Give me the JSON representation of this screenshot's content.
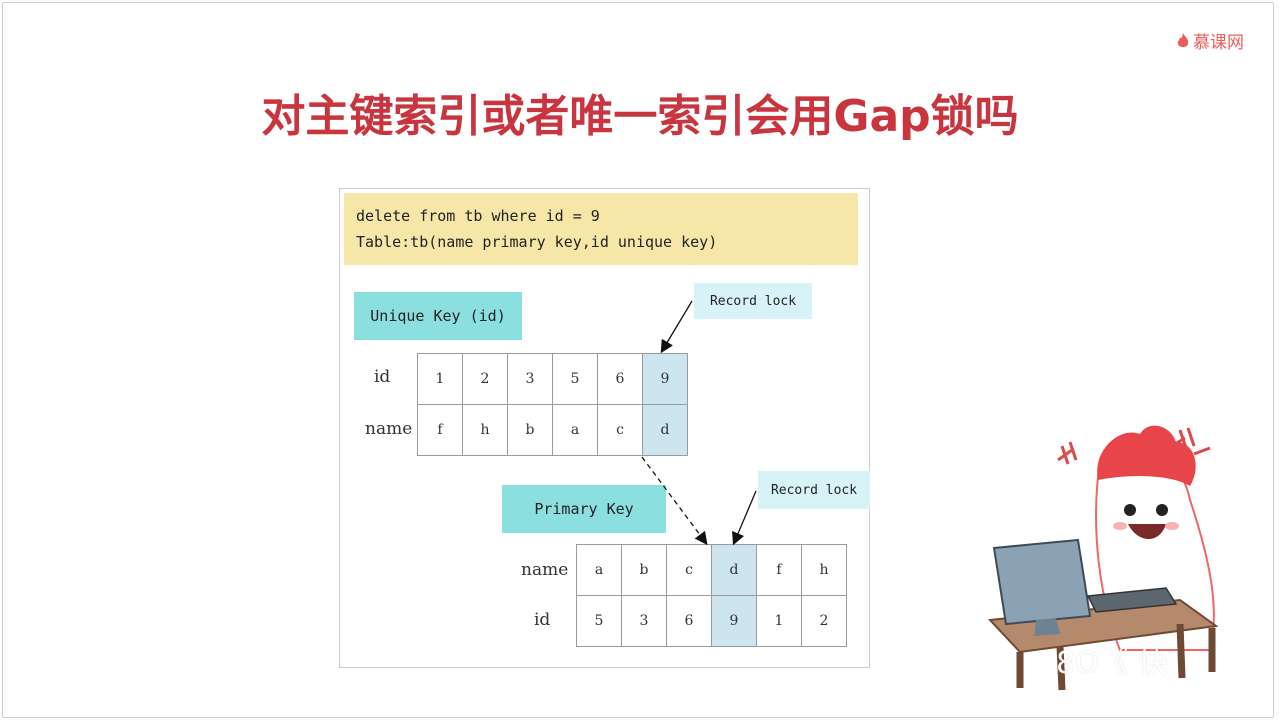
{
  "brand": {
    "text": "慕课网",
    "icon": "flame-icon",
    "color": "#f05b5b"
  },
  "slide": {
    "title": "对主键索引或者唯一索引会用Gap锁吗",
    "title_color": "#c9353f"
  },
  "diagram": {
    "sql_lines": [
      "delete from tb where id = 9",
      "Table:tb(name primary key,id unique key)"
    ],
    "unique_key": {
      "label": "Unique Key (id)",
      "callout": "Record lock",
      "row_labels": [
        "id",
        "name"
      ],
      "ids": [
        "1",
        "2",
        "3",
        "5",
        "6",
        "9"
      ],
      "names": [
        "f",
        "h",
        "b",
        "a",
        "c",
        "d"
      ],
      "highlight_index": 5
    },
    "primary_key": {
      "label": "Primary Key",
      "callout": "Record lock",
      "row_labels": [
        "name",
        "id"
      ],
      "names": [
        "a",
        "b",
        "c",
        "d",
        "f",
        "h"
      ],
      "ids": [
        "5",
        "3",
        "6",
        "9",
        "1",
        "2"
      ],
      "highlight_index": 3
    },
    "colors": {
      "sql_bg": "#f6e6a8",
      "label_bg": "#8be0df",
      "callout_bg": "#d8f3f8",
      "highlight": "#cde5ef"
    }
  },
  "watermark": {
    "text": "8O《 快"
  },
  "mascot": {
    "icon": "mascot-at-computer-icon"
  }
}
